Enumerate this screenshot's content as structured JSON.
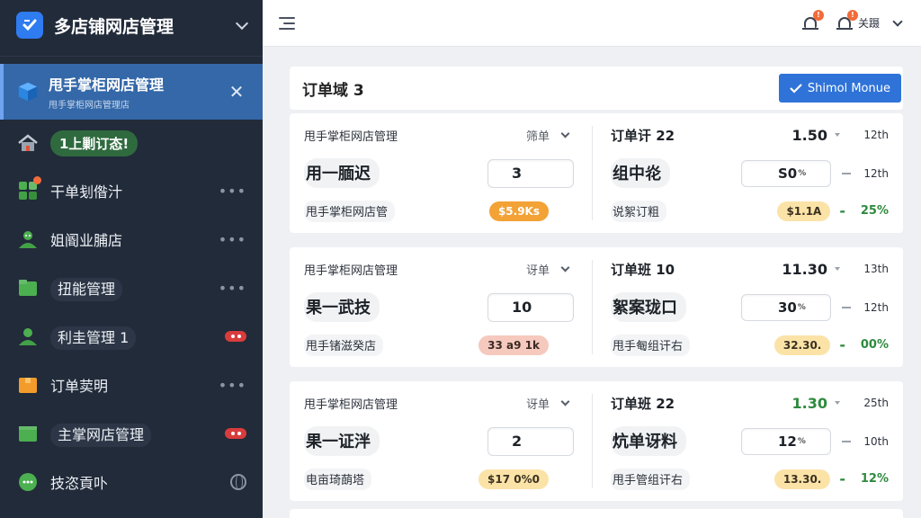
{
  "sidebar": {
    "brand": "多店铺网店管理",
    "active": {
      "title": "甩手掌柜网店管理",
      "subtitle": "甩手掌柜网店管理店"
    },
    "status_label": "1上剿订态!",
    "items": [
      {
        "label": "干单刬偺汁",
        "trail": "dots"
      },
      {
        "label": "姐阍业脯店",
        "trail": "dots"
      },
      {
        "label": "扭能管理",
        "trail": "dots"
      },
      {
        "label": "利圭管理 1",
        "trail": "badge"
      },
      {
        "label": "订单荬明",
        "trail": "dots"
      },
      {
        "label": "主掌网店管理",
        "trail": "badge"
      },
      {
        "label": "技恣貢卟",
        "trail": "globe"
      }
    ],
    "dots_text": "•••"
  },
  "topbar": {
    "notif_badge_1": "!",
    "notif_badge_2": "!",
    "user_name": "关蹑"
  },
  "header": {
    "title": "订单域 3",
    "button_label": "Shimol Monue",
    "button_icon": "check-icon"
  },
  "orders": [
    {
      "shop": "甩手掌柜网店管理",
      "select_text": "筛单",
      "product": "用一腼迟",
      "qty": "3",
      "sub_label": "甩手掌柜网店管",
      "price_chip": "$5.9Ks",
      "order_no": "订单讦 22",
      "price": "1.50",
      "meta1": "12th",
      "spec_label": "组中炛",
      "pct": "S0",
      "pct_unit": "%",
      "meta2": "12th",
      "spec_sub": "说絮订粗",
      "amount_chip": "$1.1A",
      "growth": "25%"
    },
    {
      "shop": "甩手掌柜网店管理",
      "select_text": "讶单",
      "product": "果一武技",
      "qty": "10",
      "sub_label": "甩手锗滋癸店",
      "price_chip": "33 a9 1k",
      "order_no": "订单班 10",
      "price": "11.30",
      "meta1": "13th",
      "spec_label": "絮案珑口",
      "pct": "30",
      "pct_unit": "%",
      "meta2": "12th",
      "spec_sub": "甩手匎组讦右",
      "amount_chip": "32.30.",
      "growth": "00%"
    },
    {
      "shop": "甩手掌柜网店管理",
      "select_text": "讶单",
      "product": "果一证泮",
      "qty": "2",
      "sub_label": "电亩琦蓢塔",
      "price_chip": "$17 0%0",
      "order_no": "订单班 22",
      "price": "1.30",
      "meta1": "25th",
      "spec_label": "炕单讶料",
      "pct": "12",
      "pct_unit": "%",
      "meta2": "10th",
      "spec_sub": "甩手管组讦右",
      "amount_chip": "13.30.",
      "growth": "12%"
    }
  ],
  "colors": {
    "sidebar_bg": "#222b3a",
    "active_bg": "#3468a8",
    "primary": "#2f73d8",
    "orange_chip": "#f3a236",
    "pink_chip": "#f6c9be",
    "yellow_chip": "#fbe3a8",
    "green": "#2e8a3e",
    "badge_red": "#d93c3c"
  }
}
